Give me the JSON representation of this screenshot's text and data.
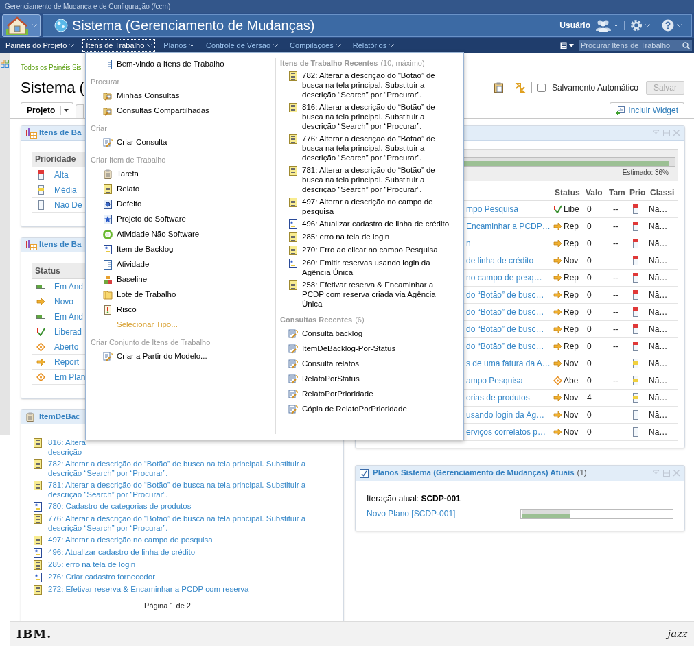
{
  "window": {
    "title": "Gerenciamento de Mudança e de Configuração (/ccm)"
  },
  "header": {
    "project": "Sistema (Gerenciamento de Mudanças)",
    "user": "Usuário"
  },
  "nav": {
    "items": [
      {
        "label": "Painéis do Projeto",
        "selected": false
      },
      {
        "label": "Itens de Trabalho",
        "selected": true
      },
      {
        "label": "Planos",
        "selected": false
      },
      {
        "label": "Controle de Versão",
        "selected": false
      },
      {
        "label": "Compilações",
        "selected": false
      },
      {
        "label": "Relatórios",
        "selected": false
      }
    ],
    "search": {
      "placeholder": "Procurar Itens de Trabalho"
    }
  },
  "breadcrumb": "Todos os Painéis Sis",
  "page_title": "Sistema (",
  "toolbar": {
    "autosave": {
      "label": "Salvamento Automático",
      "checked": false
    },
    "save": {
      "label": "Salvar",
      "disabled": true
    }
  },
  "tabs": [
    {
      "label": "Projeto",
      "selected": true
    }
  ],
  "add_widget": "Incluir Widget",
  "left_panels": [
    {
      "title": "Itens de Ba",
      "column": "Prioridade",
      "rows": [
        {
          "kind": "high",
          "label": "Alta"
        },
        {
          "kind": "medium",
          "label": "Média"
        },
        {
          "kind": "none",
          "label": "Não De"
        }
      ]
    },
    {
      "title": "Itens de Ba",
      "column": "Status",
      "rows": [
        {
          "kind": "progress",
          "label": "Em And"
        },
        {
          "kind": "arrow",
          "label": "Novo"
        },
        {
          "kind": "progress",
          "label": "Em And"
        },
        {
          "kind": "check",
          "label": "Liberad"
        },
        {
          "kind": "diamond",
          "label": "Aberto"
        },
        {
          "kind": "arrow",
          "label": "Report"
        },
        {
          "kind": "diamond",
          "label": "Em Plan"
        }
      ]
    }
  ],
  "backlog_panel": {
    "title": "ItemDeBac",
    "items": [
      {
        "kind": "relato",
        "text": "816: Altera descrição"
      },
      {
        "kind": "relato",
        "text": "782: Alterar a descrição do “Botão” de busca na tela principal. Substituir a descrição “Search” por “Procurar”."
      },
      {
        "kind": "relato",
        "text": "781: Alterar a descrição do “Botão” de busca na tela principal. Substituir a descrição “Search” por “Procurar”."
      },
      {
        "kind": "backlog",
        "text": "780: Cadastro de categorias de produtos"
      },
      {
        "kind": "relato",
        "text": "776: Alterar a descrição do “Botão” de busca na tela principal. Substituir a descrição “Search” por “Procurar”."
      },
      {
        "kind": "relato",
        "text": "497: Alterar a descrição no campo de pesquisa"
      },
      {
        "kind": "backlog",
        "text": "496: Atuallzar cadastro de linha de crédito"
      },
      {
        "kind": "relato",
        "text": "285: erro na tela de login"
      },
      {
        "kind": "backlog",
        "text": "276: Criar cadastro fornecedor"
      },
      {
        "kind": "relato",
        "text": "272: Efetivar reserva & Encaminhar a PCDP com reserva"
      }
    ],
    "pager": "Página 1 de 2"
  },
  "work_table": {
    "estimate": "Estimado: 36%",
    "level": 0.97,
    "columns": [
      "Status",
      "Valo",
      "Tam",
      "Prio",
      "Classi"
    ],
    "rows": [
      {
        "name": "mpo Pesquisa",
        "status": {
          "kind": "check",
          "text": "Libe"
        },
        "value": "0",
        "size": "--",
        "priority": {
          "kind": "high"
        },
        "class": "Nã…"
      },
      {
        "name": "Encaminhar a PCDP…",
        "status": {
          "kind": "arrow",
          "text": "Rep"
        },
        "value": "0",
        "size": "--",
        "priority": {
          "kind": "high"
        },
        "class": "Nã…"
      },
      {
        "name": "n",
        "status": {
          "kind": "arrow",
          "text": "Rep"
        },
        "value": "0",
        "size": "--",
        "priority": {
          "kind": "high"
        },
        "class": "Nã…"
      },
      {
        "name": "de linha de crédito",
        "status": {
          "kind": "arrow",
          "text": "Nov"
        },
        "value": "0",
        "priority": {
          "kind": "high"
        },
        "class": "Nã…"
      },
      {
        "name": "no campo de pesq…",
        "status": {
          "kind": "arrow",
          "text": "Rep"
        },
        "value": "0",
        "size": "--",
        "priority": {
          "kind": "high"
        },
        "class": "Nã…"
      },
      {
        "name": "do “Botão” de busc…",
        "status": {
          "kind": "arrow",
          "text": "Rep"
        },
        "value": "0",
        "size": "--",
        "priority": {
          "kind": "high"
        },
        "class": "Nã…"
      },
      {
        "name": "do “Botão” de busc…",
        "status": {
          "kind": "arrow",
          "text": "Rep"
        },
        "value": "0",
        "size": "--",
        "priority": {
          "kind": "high"
        },
        "class": "Nã…"
      },
      {
        "name": "do “Botão” de busc…",
        "status": {
          "kind": "arrow",
          "text": "Rep"
        },
        "value": "0",
        "size": "--",
        "priority": {
          "kind": "high"
        },
        "class": "Nã…"
      },
      {
        "name": "do “Botão” de busc…",
        "status": {
          "kind": "arrow",
          "text": "Rep"
        },
        "value": "0",
        "size": "--",
        "priority": {
          "kind": "high"
        },
        "class": "Nã…"
      },
      {
        "name": "s de uma fatura da A…",
        "status": {
          "kind": "arrow",
          "text": "Nov"
        },
        "value": "0",
        "priority": {
          "kind": "medium"
        },
        "class": "Nã…"
      },
      {
        "name": "ampo Pesquisa",
        "status": {
          "kind": "diamond",
          "text": "Abe"
        },
        "value": "0",
        "size": "--",
        "priority": {
          "kind": "medium"
        },
        "class": "Nã…"
      },
      {
        "name": "orias de produtos",
        "status": {
          "kind": "arrow",
          "text": "Nov"
        },
        "value": "4",
        "priority": {
          "kind": "medium"
        },
        "class": "Nã…"
      },
      {
        "name": "usando login da Ag…",
        "status": {
          "kind": "arrow",
          "text": "Nov"
        },
        "value": "0",
        "priority": {
          "kind": "none"
        },
        "class": "Nã…"
      },
      {
        "name": "erviços correlatos p…",
        "status": {
          "kind": "arrow",
          "text": "Nov"
        },
        "value": "0",
        "priority": {
          "kind": "none"
        },
        "class": "Nã…"
      }
    ]
  },
  "plans_panel": {
    "title": "Planos Sistema (Gerenciamento de Mudanças) Atuais",
    "count": "(1)",
    "current": "Iteração atual: **SCDP-001**",
    "plan": "Novo Plano [SCDP-001]",
    "level": 0.32
  },
  "menu": {
    "left": [
      {
        "kind": "welcome",
        "label": "Bem-vindo a Itens de Trabalho"
      },
      {
        "kind": "header",
        "label": "Procurar"
      },
      {
        "kind": "query",
        "label": "Minhas Consultas"
      },
      {
        "kind": "query",
        "label": "Consultas Compartilhadas"
      },
      {
        "kind": "header",
        "label": "Criar"
      },
      {
        "kind": "create",
        "label": "Criar Consulta"
      },
      {
        "kind": "header",
        "label": "Criar Item de Trabalho"
      },
      {
        "kind": "tarefa",
        "label": "Tarefa"
      },
      {
        "kind": "relato",
        "label": "Relato"
      },
      {
        "kind": "defeito",
        "label": "Defeito"
      },
      {
        "kind": "projeto",
        "label": "Projeto de Software"
      },
      {
        "kind": "ring",
        "label": "Atividade Não Software"
      },
      {
        "kind": "backlog",
        "label": "Item de Backlog"
      },
      {
        "kind": "welcome",
        "label": "Atividade"
      },
      {
        "kind": "baseline",
        "label": "Baseline"
      },
      {
        "kind": "lote",
        "label": "Lote de Trabalho"
      },
      {
        "kind": "risco",
        "label": "Risco"
      },
      {
        "kind": "link",
        "label": "Selecionar Tipo..."
      },
      {
        "kind": "header",
        "label": "Criar Conjunto de Itens de Trabalho"
      },
      {
        "kind": "create",
        "label": "Criar a Partir do Modelo..."
      }
    ],
    "recent": {
      "title": "Itens de Trabalho Recentes",
      "note": "(10, máximo)",
      "items": [
        {
          "kind": "relato",
          "text": "782: Alterar a descrição do “Botão” de busca na tela principal. Substituir a descrição “Search” por “Procurar”."
        },
        {
          "kind": "relato",
          "text": "816: Alterar a descrição do “Botão” de busca na tela principal. Substituir a descrição “Search” por “Procurar”."
        },
        {
          "kind": "relato",
          "text": "776: Alterar a descrição do “Botão” de busca na tela principal. Substituir a descrição “Search” por “Procurar”."
        },
        {
          "kind": "relato",
          "text": "781: Alterar a descrição do “Botão” de busca na tela principal. Substituir a descrição “Search” por “Procurar”."
        },
        {
          "kind": "relato",
          "text": "497: Alterar a descrição no campo de pesquisa"
        },
        {
          "kind": "backlog",
          "text": "496: Atuallzar cadastro de linha de crédito"
        },
        {
          "kind": "relato",
          "text": "285: erro na tela de login"
        },
        {
          "kind": "relato",
          "text": "270: Erro ao clicar no campo Pesquisa"
        },
        {
          "kind": "backlog",
          "text": "260: Emitir reservas usando login da Agência Única"
        },
        {
          "kind": "relato",
          "text": "258: Efetivar reserva & Encaminhar a PCDP com reserva criada via Agência Única"
        }
      ]
    },
    "queries": {
      "title": "Consultas Recentes",
      "note": "(6)",
      "items": [
        "Consulta backlog",
        "ItemDeBacklog-Por-Status",
        "Consulta relatos",
        "RelatoPorStatus",
        "RelatoPorPrioridade",
        "Cópia de RelatoPorPrioridade"
      ]
    }
  },
  "footer": {
    "left_logo": "IBM.",
    "right_logo": "jazz"
  }
}
